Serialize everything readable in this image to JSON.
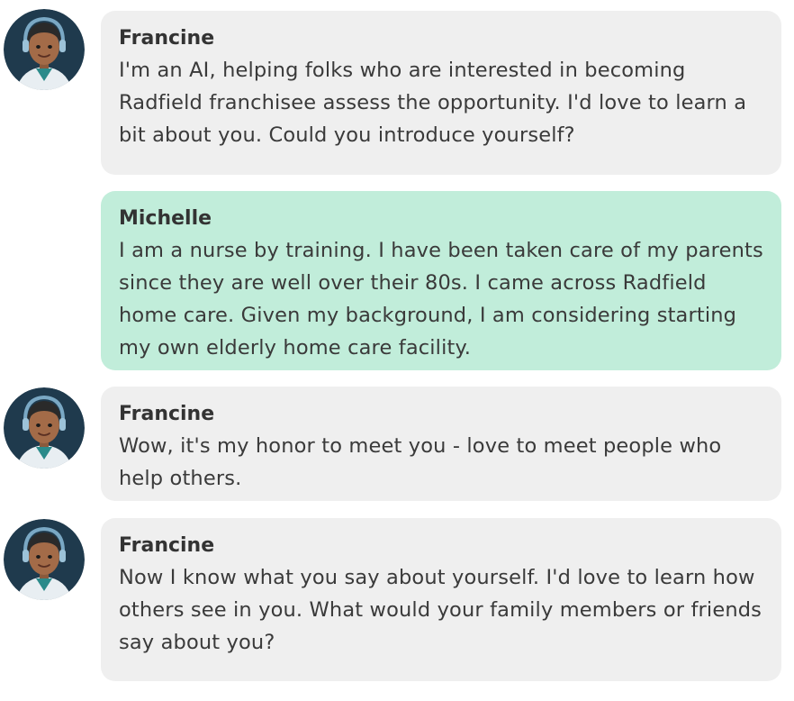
{
  "messages": [
    {
      "sender": "Francine",
      "role": "bot",
      "avatar_icon": "female-ai-avatar-icon",
      "text": "I'm an AI, helping folks who are interested in becoming Radfield franchisee assess the opportunity. I'd love to learn a bit about you. Could you introduce yourself?"
    },
    {
      "sender": "Michelle",
      "role": "user",
      "text": "I am a nurse by training. I have been taken care of my parents since they are well over their 80s. I came across Radfield home care. Given my background, I am considering starting my own elderly home care facility."
    },
    {
      "sender": "Francine",
      "role": "bot",
      "avatar_icon": "female-ai-avatar-icon",
      "text": "Wow, it's my honor to meet you - love to meet people who help others."
    },
    {
      "sender": "Francine",
      "role": "bot",
      "avatar_icon": "female-ai-avatar-icon",
      "text": "Now I know what you say about yourself. I'd love to learn how others see in you. What would your family members or friends say about you?"
    }
  ],
  "colors": {
    "bot_bubble": "#efefef",
    "user_bubble": "#c1edda",
    "avatar_bg": "#1f3a4d"
  }
}
